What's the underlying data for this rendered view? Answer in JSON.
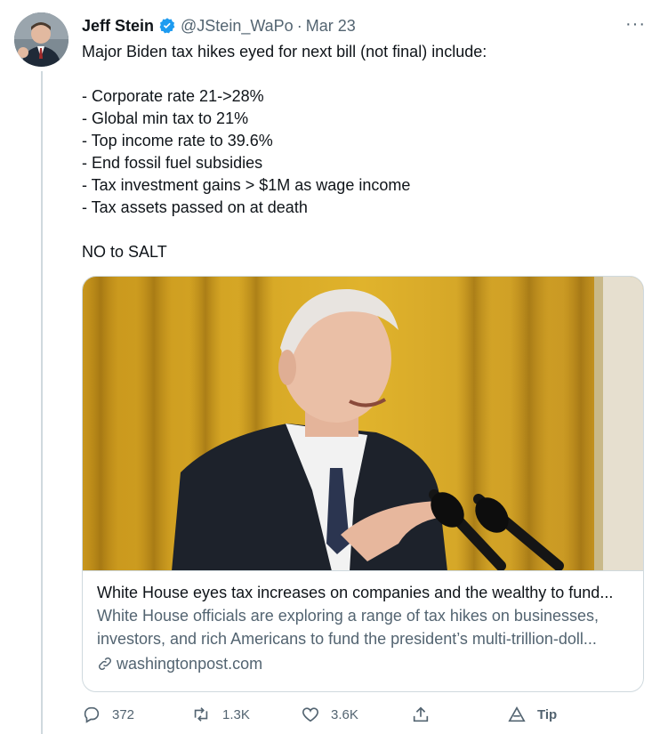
{
  "tweet": {
    "author_name": "Jeff Stein",
    "handle": "@JStein_WaPo",
    "separator": "·",
    "date": "Mar 23",
    "more_label": "···",
    "lines": [
      "Major Biden tax hikes eyed for next bill (not final) include:",
      "",
      "- Corporate rate 21->28%",
      "- Global min tax to 21%",
      "- Top income rate to 39.6%",
      "- End fossil fuel subsidies",
      "- Tax investment gains > $1M as wage income",
      "- Tax assets passed on at death",
      "",
      "NO to SALT"
    ]
  },
  "card": {
    "title": "White House eyes tax increases on companies and the wealthy to fund...",
    "description_line1": "White House officials are exploring a range of tax hikes on businesses,",
    "description_line2": "investors, and rich Americans to fund the president’s multi-trillion-doll...",
    "domain": "washingtonpost.com"
  },
  "actions": {
    "replies": "372",
    "retweets": "1.3K",
    "likes": "3.6K",
    "tip": "Tip"
  },
  "icons": {
    "verified": "verified-badge-icon",
    "reply": "reply-icon",
    "retweet": "retweet-icon",
    "like": "heart-icon",
    "share": "share-icon",
    "tip": "tip-icon",
    "link": "link-icon",
    "more": "more-icon"
  },
  "colors": {
    "verified": "#1d9bf0",
    "secondary_text": "#536471",
    "border": "#cfd9de"
  }
}
